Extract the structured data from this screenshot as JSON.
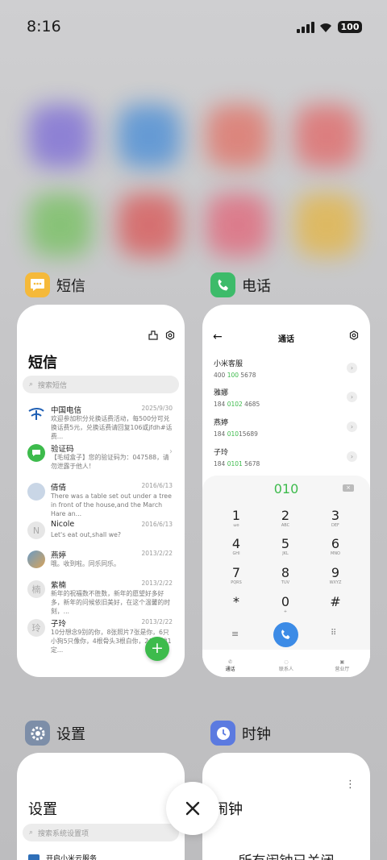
{
  "status_bar": {
    "time": "8:16",
    "battery": "100"
  },
  "apps": {
    "messages": {
      "name": "短信",
      "title": "短信",
      "search_placeholder": "搜索短信",
      "items": [
        {
          "name": "中国电信",
          "date": "2025/9/30",
          "preview": "欢迎参加积分兑换话费活动，每500分可兑换话费5元，兑换话费请回复106或jfdh#话费..."
        },
        {
          "name": "验证码",
          "date": "",
          "preview": "【毛绒盒子】您的验证码为：047588，请勿泄露于他人！"
        },
        {
          "name": "倩倩",
          "date": "2016/6/13",
          "preview": "There was a table set out under a tree in front of the house,and the March Hare an..."
        },
        {
          "name": "Nicole",
          "date": "2016/6/13",
          "preview": "Let's eat out,shall we?"
        },
        {
          "name": "燕婷",
          "date": "2013/2/22",
          "preview": "哦。收到啦。同乐同乐。"
        },
        {
          "name": "紫楠",
          "date": "2013/2/22",
          "preview": "新年的祝福数不胜数，新年的愿望好多好多，新年的问候依旧美好，在这个温馨的时刻，..."
        },
        {
          "name": "子玲",
          "date": "2013/2/22",
          "preview": "10分想念9别的你，8张照片7张是你，6只小狗5只像你，4根骨头3根白你，2爪着地1定..."
        }
      ],
      "avatar_initials": {
        "nicole": "N",
        "zinan": "楠",
        "ziling": "玲"
      }
    },
    "phone": {
      "name": "电话",
      "header_title": "通话",
      "contacts": [
        {
          "name": "小米客服",
          "num_a": "400 ",
          "num_b": "100",
          "num_c": " 5678"
        },
        {
          "name": "雅娜",
          "num_a": "184 ",
          "num_b": "0102",
          "num_c": " 4685"
        },
        {
          "name": "燕婷",
          "num_a": "184 ",
          "num_b": "010",
          "num_c": "15689"
        },
        {
          "name": "子玲",
          "num_a": "184 ",
          "num_b": "0101",
          "num_c": " 5678"
        }
      ],
      "dialed": "010",
      "keys": [
        {
          "d": "1",
          "l": "ωo"
        },
        {
          "d": "2",
          "l": "ABC"
        },
        {
          "d": "3",
          "l": "DEF"
        },
        {
          "d": "4",
          "l": "GHI"
        },
        {
          "d": "5",
          "l": "JKL"
        },
        {
          "d": "6",
          "l": "MNO"
        },
        {
          "d": "7",
          "l": "PQRS"
        },
        {
          "d": "8",
          "l": "TUV"
        },
        {
          "d": "9",
          "l": "WXYZ"
        },
        {
          "d": "*",
          "l": ""
        },
        {
          "d": "0",
          "l": "+"
        },
        {
          "d": "#",
          "l": ""
        }
      ],
      "nav": {
        "calls": "通话",
        "contacts": "联系人",
        "hall": "营业厅"
      }
    },
    "settings": {
      "name": "设置",
      "title": "设置",
      "search_placeholder": "搜索系统设置项",
      "first_item": "开启小米云服务"
    },
    "clock": {
      "name": "时钟",
      "title": "闹钟",
      "status": "所有闹钟已关闭"
    }
  },
  "colors": {
    "accent_green": "#3dbb4c",
    "call_blue": "#3c8be6",
    "card_bg": "#ffffff"
  }
}
